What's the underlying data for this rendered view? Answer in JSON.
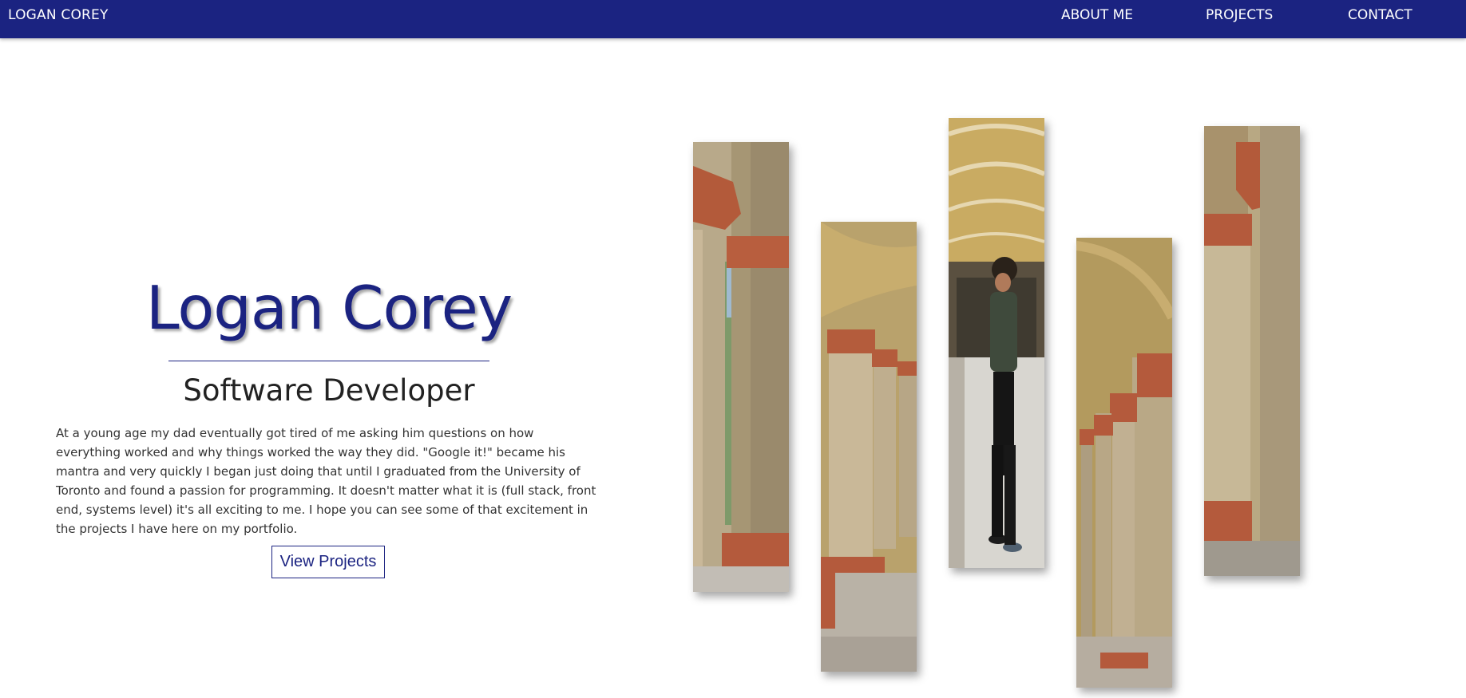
{
  "nav": {
    "brand": "LOGAN COREY",
    "links": [
      {
        "label": "ABOUT ME"
      },
      {
        "label": "PROJECTS"
      },
      {
        "label": "CONTACT"
      }
    ]
  },
  "hero": {
    "name": "Logan Corey",
    "role": "Software Developer",
    "bio": "At a young age my dad eventually got tired of me asking him questions on how everything worked and why things worked the way they did. \"Google it!\" became his mantra and very quickly I began just doing that until I graduated from the University of Toronto and found a passion for programming. It doesn't matter what it is (full stack, front end, systems level) it's all exciting to me. I hope you can see some of that excitement in the projects I have here on my portfolio.",
    "cta_label": "View Projects"
  },
  "gallery": {
    "strips": [
      {
        "subject": "colonnade-archway"
      },
      {
        "subject": "colonnade-pillars"
      },
      {
        "subject": "person-in-arcade"
      },
      {
        "subject": "colonnade-pillars"
      },
      {
        "subject": "pillar-closeup"
      }
    ]
  },
  "colors": {
    "primary": "#1b2381",
    "background": "#ffffff",
    "text": "#333333"
  }
}
